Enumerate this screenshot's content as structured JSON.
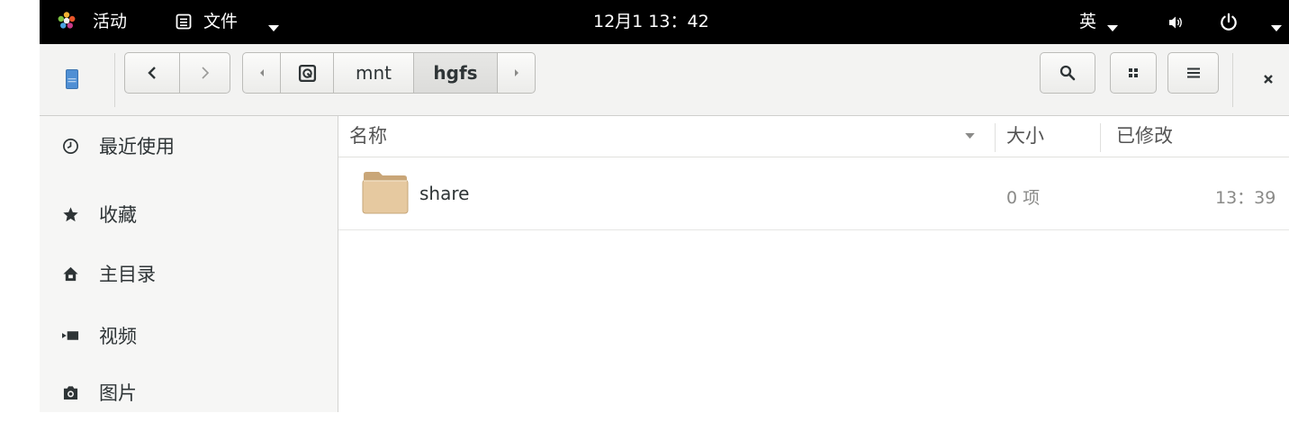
{
  "topbar": {
    "activities": "活动",
    "app_menu": "文件",
    "clock": "12月1 13：42",
    "input_method": "英"
  },
  "pathbar": {
    "segments": [
      "mnt",
      "hgfs"
    ],
    "active": "hgfs"
  },
  "sidebar": {
    "items": [
      {
        "label": "最近使用",
        "icon": "clock-icon"
      },
      {
        "label": "收藏",
        "icon": "star-icon"
      },
      {
        "label": "主目录",
        "icon": "home-icon"
      },
      {
        "label": "视频",
        "icon": "video-icon"
      },
      {
        "label": "图片",
        "icon": "camera-icon"
      }
    ]
  },
  "list": {
    "columns": {
      "name": "名称",
      "size": "大小",
      "modified": "已修改"
    },
    "rows": [
      {
        "name": "share",
        "size": "0 项",
        "modified": "13：39"
      }
    ]
  },
  "colors": {
    "topbar_bg": "#000000",
    "header_bg": "#f3f3f2",
    "sidebar_bg": "#f6f6f5",
    "folder": "#e6c9a0"
  }
}
